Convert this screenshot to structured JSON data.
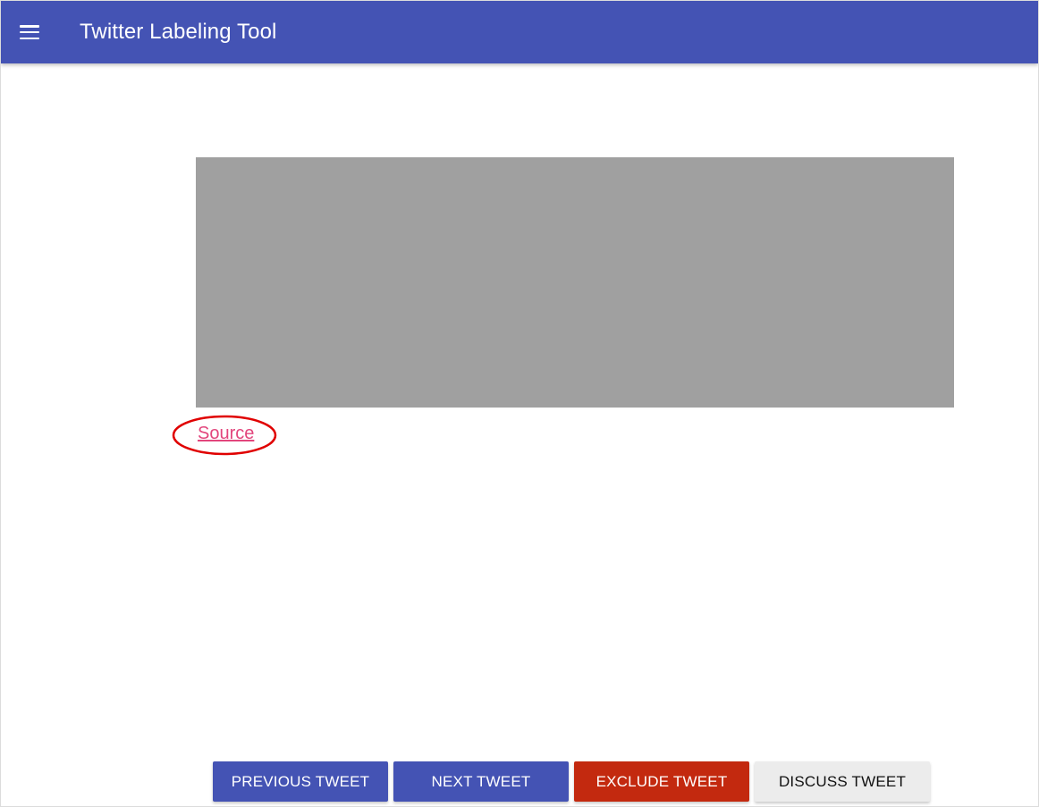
{
  "app_bar": {
    "title": "Twitter Labeling Tool",
    "menu_icon": "hamburger-menu-icon",
    "background": "#4453b4"
  },
  "tweet": {
    "source_label": "Source",
    "source_color": "#e2457c",
    "highlight_color": "#e00000"
  },
  "actions": {
    "previous_label": "PREVIOUS TWEET",
    "next_label": "NEXT TWEET",
    "exclude_label": "EXCLUDE TWEET",
    "discuss_label": "DISCUSS TWEET"
  }
}
